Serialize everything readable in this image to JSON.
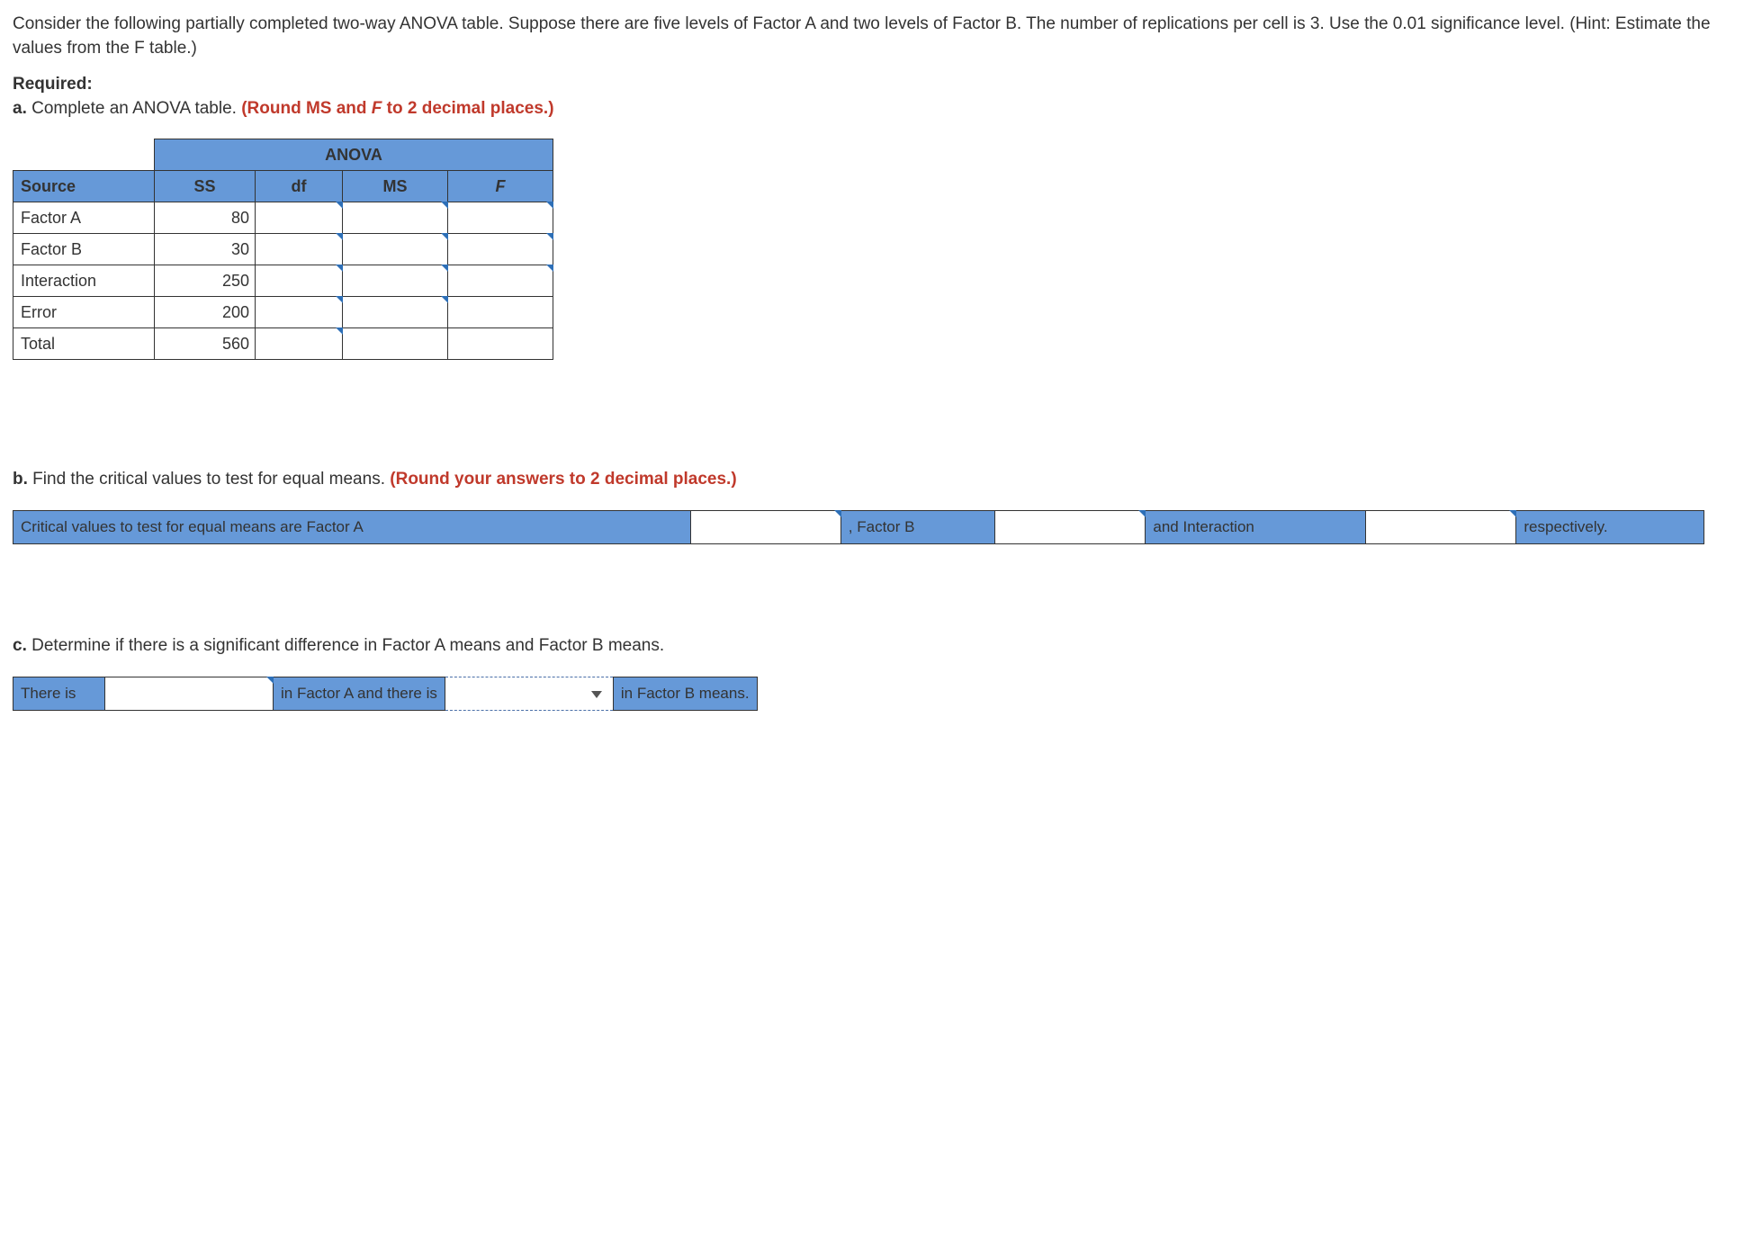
{
  "problem": {
    "text": "Consider the following partially completed two-way ANOVA table. Suppose there are five levels of Factor A and two levels of Factor B. The number of replications per cell is 3. Use the 0.01 significance level. (Hint: Estimate the values from the F table.)"
  },
  "required_label": "Required:",
  "part_a": {
    "label": "a.",
    "text": "Complete an ANOVA table.",
    "hint": "(Round MS and F to 2 decimal places.)"
  },
  "anova": {
    "title": "ANOVA",
    "headers": {
      "source": "Source",
      "ss": "SS",
      "df": "df",
      "ms": "MS",
      "f": "F"
    },
    "rows": [
      {
        "source": "Factor A",
        "ss": "80"
      },
      {
        "source": "Factor B",
        "ss": "30"
      },
      {
        "source": "Interaction",
        "ss": "250"
      },
      {
        "source": "Error",
        "ss": "200"
      },
      {
        "source": "Total",
        "ss": "560"
      }
    ]
  },
  "part_b": {
    "label": "b.",
    "text": "Find the critical values to test for equal means.",
    "hint": "(Round your answers to 2 decimal places.)",
    "sentence": {
      "s1": "Critical values to test for equal means are Factor A",
      "s2": ", Factor B",
      "s3": "and Interaction",
      "s4": "respectively."
    }
  },
  "part_c": {
    "label": "c.",
    "text": "Determine if there is a significant difference in Factor A means and Factor B means.",
    "sentence": {
      "s1": "There is",
      "s2": "in Factor A and there is",
      "s3": "in Factor B means."
    }
  }
}
